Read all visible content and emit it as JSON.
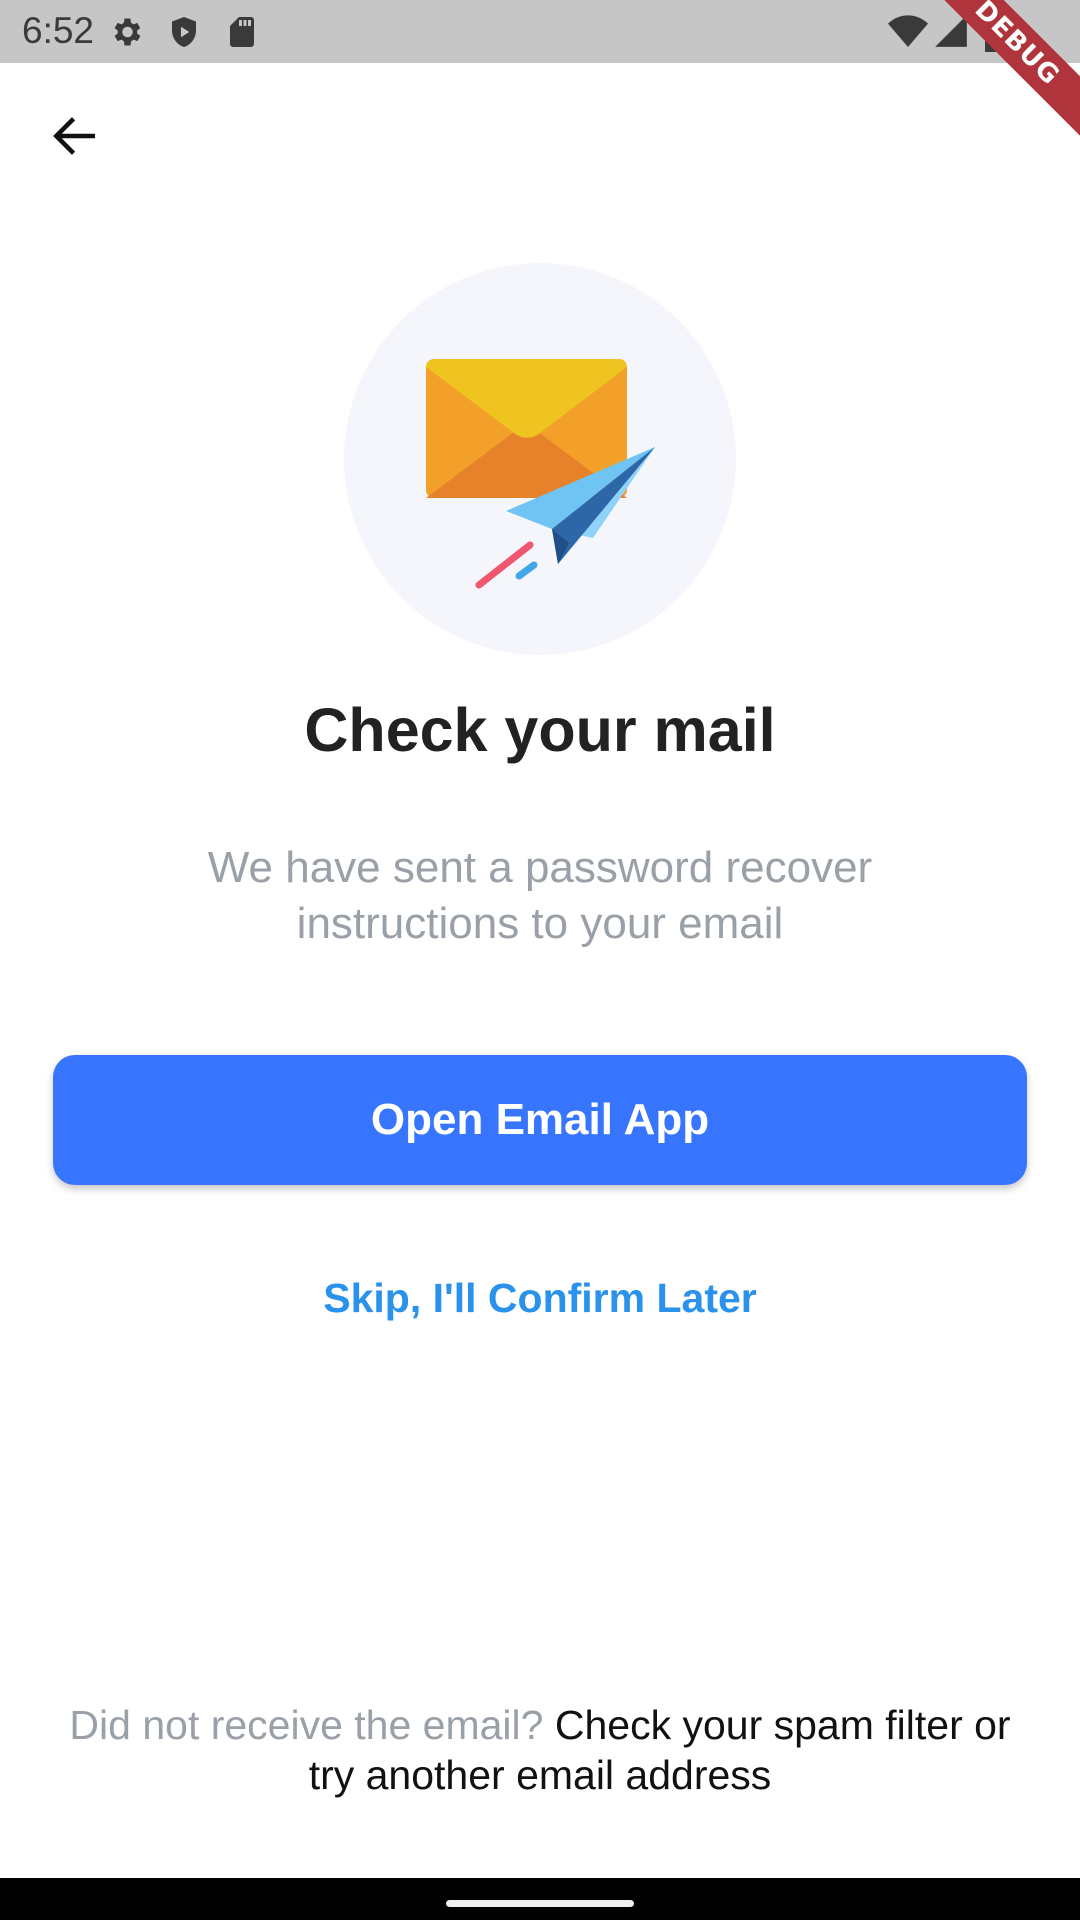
{
  "status_bar": {
    "time": "6:52",
    "icons_left": [
      "gear-icon",
      "shield-play-icon",
      "sd-card-icon"
    ],
    "icons_right": [
      "wifi-icon",
      "cell-signal-icon",
      "battery-icon"
    ],
    "debug_banner": "DEBUG",
    "background_color": "#c6c6c6"
  },
  "header": {
    "back_icon": "arrow-left-icon"
  },
  "illustration": {
    "icon": "mail-paper-plane-icon"
  },
  "content": {
    "title": "Check your mail",
    "subtitle": "We have sent a password recover instructions to your email",
    "primary_button_label": "Open Email App",
    "skip_label": "Skip, I'll Confirm Later"
  },
  "footer": {
    "muted_text": "Did not receive the email?",
    "action_text": "Check your spam filter or try another email address"
  },
  "colors": {
    "primary": "#3875fe",
    "link": "#2a92ea",
    "muted": "#9aa0a8",
    "title": "#222222"
  }
}
